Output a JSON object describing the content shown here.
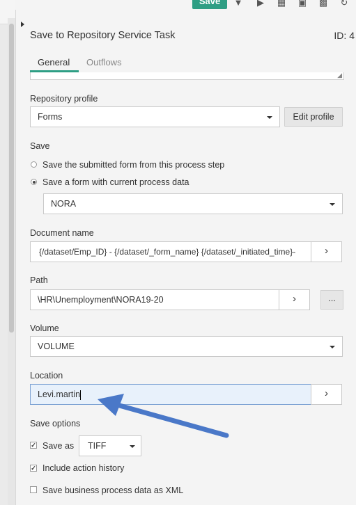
{
  "toolbar": {
    "save_label": "Save",
    "icons": [
      "caret-down-icon",
      "play-icon",
      "grid-icon",
      "image-icon",
      "save-disk-icon",
      "refresh-icon"
    ]
  },
  "header": {
    "title": "Save to Repository Service Task",
    "id": "ID: 4"
  },
  "tabs": [
    {
      "label": "General",
      "active": true
    },
    {
      "label": "Outflows",
      "active": false
    }
  ],
  "repository_profile": {
    "label": "Repository profile",
    "value": "Forms",
    "edit_label": "Edit profile"
  },
  "save": {
    "label": "Save",
    "options": [
      {
        "label": "Save the submitted form from this process step",
        "selected": false
      },
      {
        "label": "Save a form with current process data",
        "selected": true
      }
    ],
    "form_value": "NORA"
  },
  "document_name": {
    "label": "Document name",
    "value": "{/dataset/Emp_ID} - {/dataset/_form_name} {/dataset/_initiated_time}-"
  },
  "path": {
    "label": "Path",
    "value": "\\HR\\Unemployment\\NORA19-20",
    "browse_label": "..."
  },
  "volume": {
    "label": "Volume",
    "value": "VOLUME"
  },
  "location": {
    "label": "Location",
    "value": "Levi.martin"
  },
  "save_options": {
    "label": "Save options",
    "save_as_label": "Save as",
    "save_as_checked": true,
    "save_as_format": "TIFF",
    "include_history_label": "Include action history",
    "include_history_checked": true,
    "business_xml_label": "Save business process data as XML",
    "business_xml_checked": false
  },
  "colors": {
    "accent": "#2e9e84",
    "annotation_arrow": "#4a78c8",
    "location_highlight": "#e8f1fb"
  }
}
